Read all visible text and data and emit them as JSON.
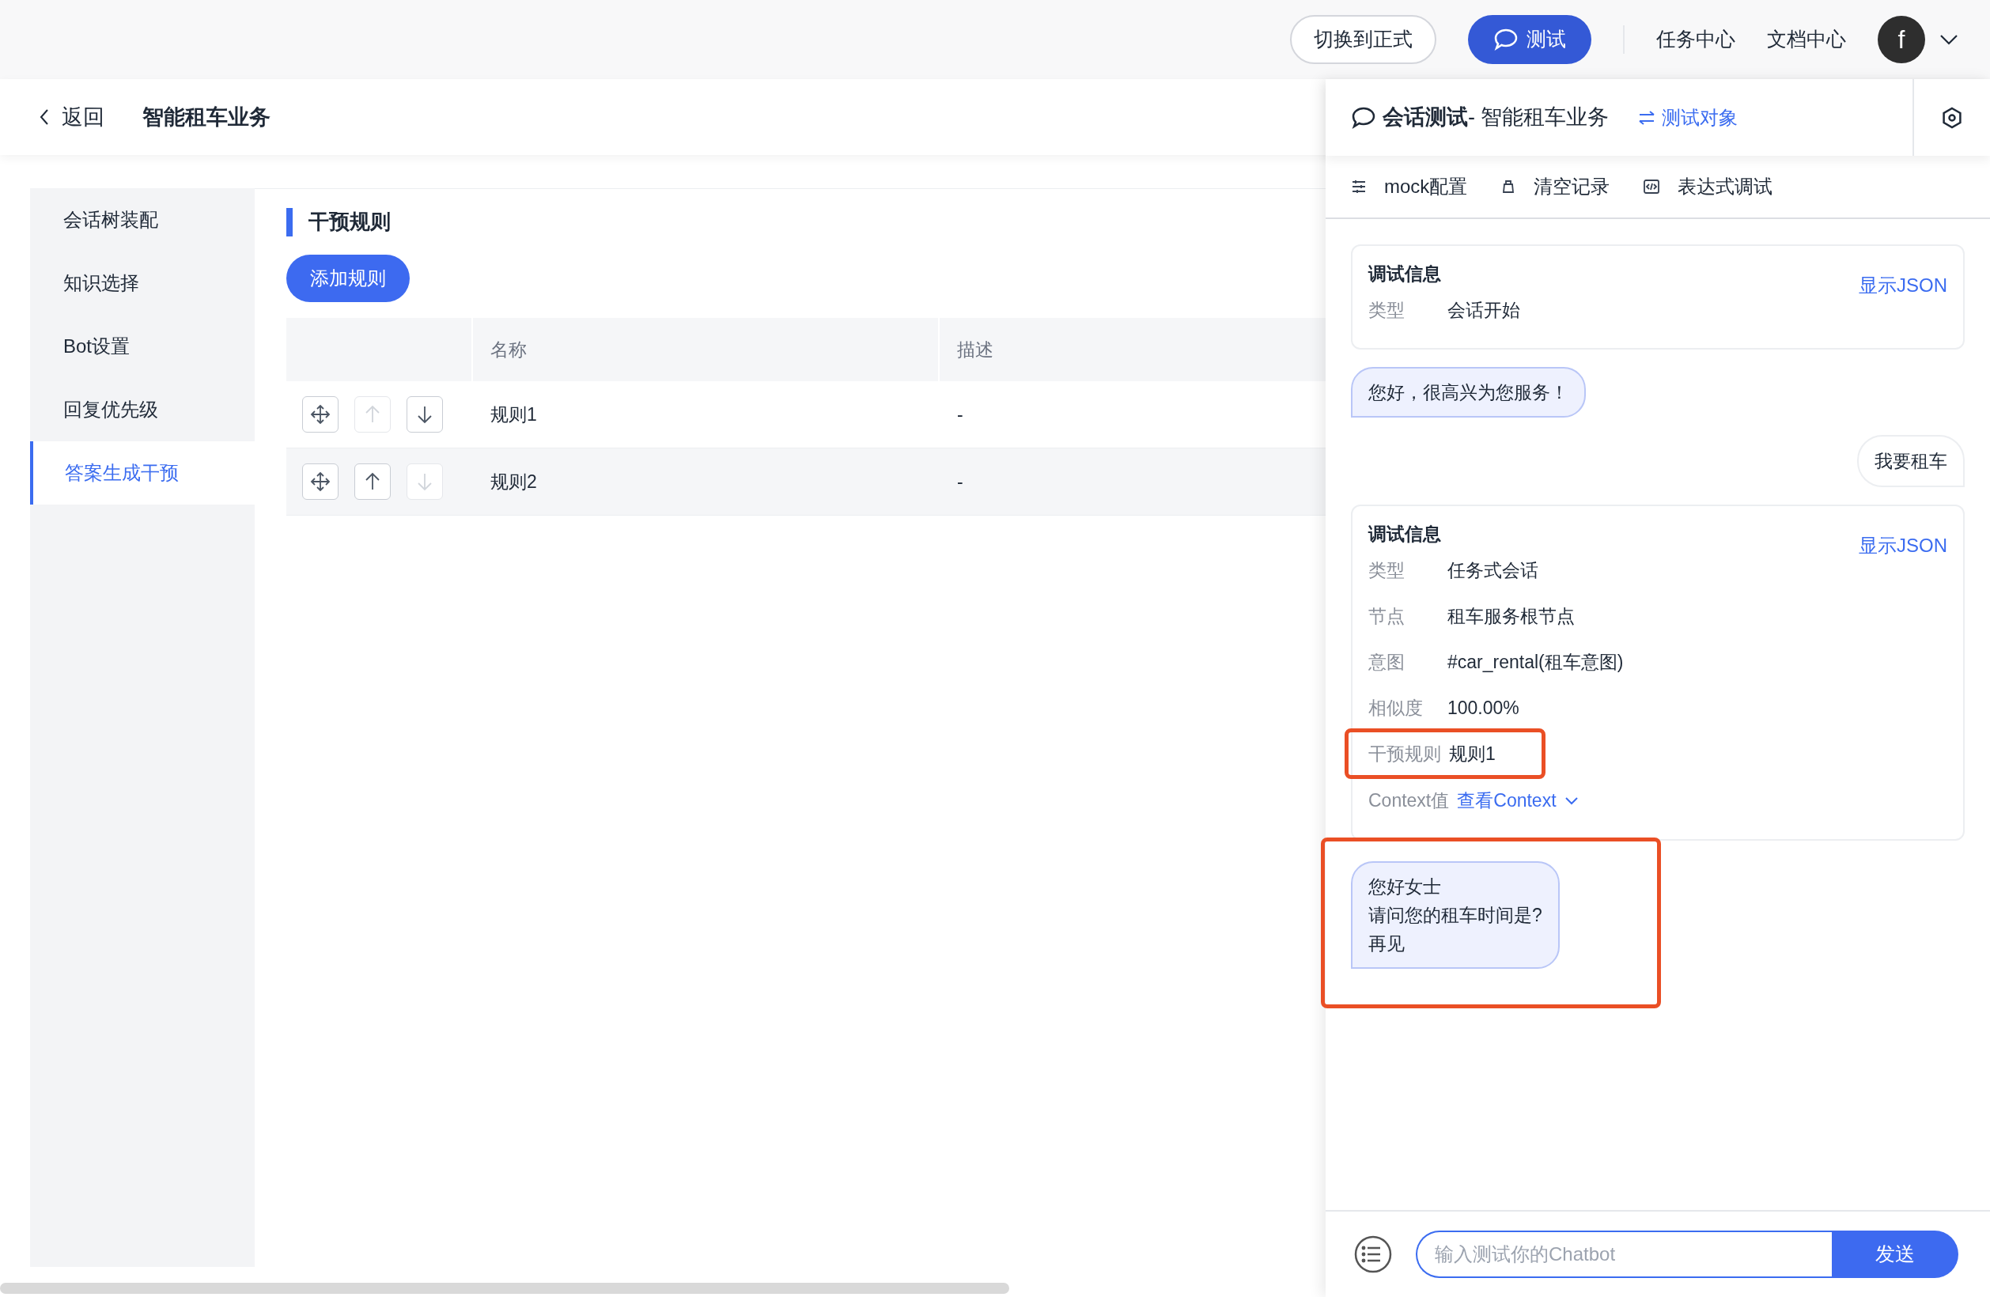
{
  "top_bar": {
    "buttons": [
      {
        "label": "切换到正式",
        "kind": "outline"
      },
      {
        "label": "测试",
        "kind": "primary"
      }
    ],
    "links": [
      "任务中心",
      "文档中心"
    ],
    "avatar": "f"
  },
  "page_header": {
    "back": "返回",
    "title": "智能租车业务"
  },
  "sidebar": {
    "items": [
      {
        "label": "会话树装配",
        "selected": false
      },
      {
        "label": "知识选择",
        "selected": false
      },
      {
        "label": "Bot设置",
        "selected": false
      },
      {
        "label": "回复优先级",
        "selected": false
      },
      {
        "label": "答案生成干预",
        "selected": true
      }
    ]
  },
  "section": {
    "title": "干预规则",
    "add_button": "添加规则"
  },
  "table": {
    "columns": [
      "名称",
      "描述"
    ],
    "rows": [
      {
        "name": "规则1",
        "description": "-",
        "up_disabled": true,
        "down_disabled": false
      },
      {
        "name": "规则2",
        "description": "-",
        "up_disabled": false,
        "down_disabled": true
      }
    ]
  },
  "chat_panel": {
    "title": "**会话测试**- 智能租车业务",
    "switch_link": "测试对象",
    "toolbar": [
      {
        "label": "mock配置",
        "kind": "sliders"
      },
      {
        "label": "清空记录",
        "kind": "bag"
      },
      {
        "label": "表达式调试",
        "kind": "code"
      }
    ],
    "messages": [
      {
        "kind": "debug",
        "title": "调试信息",
        "link": "显示JSON",
        "fields": [
          {
            "label": "类型",
            "value": "会话开始",
            "kind": "plain"
          }
        ]
      },
      {
        "kind": "bot",
        "lines": [
          "您好，很高兴为您服务！"
        ]
      },
      {
        "kind": "user",
        "lines": [
          "我要租车"
        ]
      },
      {
        "kind": "debug",
        "title": "调试信息",
        "link": "显示JSON",
        "fields": [
          {
            "label": "类型",
            "value": "任务式会话",
            "kind": "plain"
          },
          {
            "label": "节点",
            "value": "租车服务根节点",
            "kind": "plain"
          },
          {
            "label": "意图",
            "value": "#car_rental(租车意图)",
            "kind": "plain"
          },
          {
            "label": "相似度",
            "value": "100.00%",
            "kind": "plain"
          },
          {
            "label": "干预规则",
            "value": "规则1",
            "kind": "framed"
          }
        ],
        "context": {
          "label": "Context值",
          "link": "查看Context"
        }
      },
      {
        "kind": "bot_framed",
        "lines": [
          "您好女士",
          "请问您的租车时间是?",
          "再见"
        ]
      }
    ],
    "input": {
      "placeholder": "输入测试你的Chatbot",
      "send": "发送"
    }
  }
}
